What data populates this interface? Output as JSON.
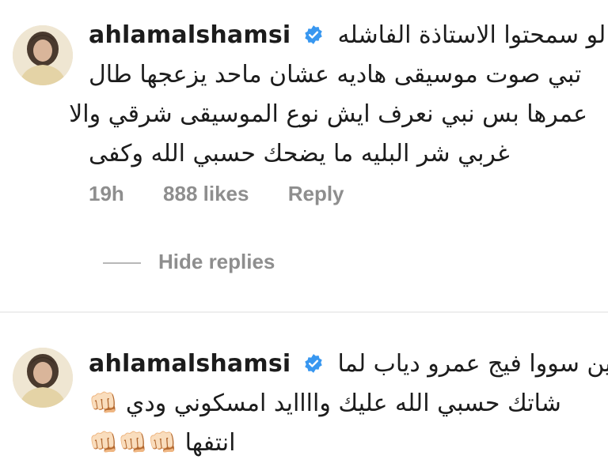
{
  "comments": [
    {
      "username": "ahlamalshamsi",
      "verified": true,
      "lines": [
        "لو سمحتوا الاستاذة الفاشله",
        "تبي صوت موسيقى هاديه عشان  ماحد يزعجها طال",
        "عمرها بس نبي نعرف ايش نوع الموسيقى شرقي والا",
        "غربي شر البليه ما يضحك حسبي الله وكفى"
      ],
      "time": "19h",
      "likes": "888 likes",
      "reply": "Reply"
    },
    {
      "username": "ahlamalshamsi",
      "verified": true,
      "lines": [
        "زين سووا فيج عمرو دياب لما",
        "شاتك حسبي الله عليك واااايد امسكوني ودي 👊🏻",
        "انتفها 👊🏻👊🏻👊🏻"
      ]
    }
  ],
  "hide_replies": "Hide replies",
  "colors": {
    "verified_badge": "#3897f0",
    "meta_text": "#8e8e8e"
  },
  "icons": [
    "verified-badge-icon",
    "raised-fist-icon"
  ]
}
